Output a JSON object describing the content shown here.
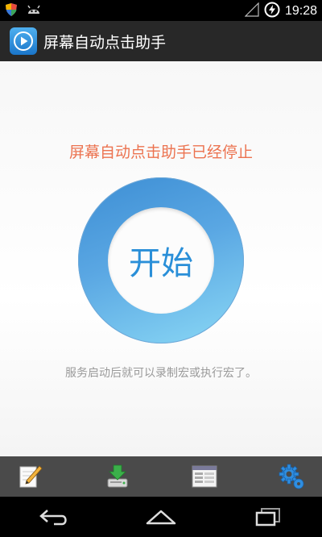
{
  "status_bar": {
    "time": "19:28",
    "icons": [
      "shield-icon",
      "android-robot-icon",
      "signal-icon",
      "battery-charging-icon"
    ]
  },
  "action_bar": {
    "title": "屏幕自动点击助手",
    "icon": "play-icon"
  },
  "main": {
    "status_message": "屏幕自动点击助手已经停止",
    "start_button_label": "开始",
    "hint": "服务启动后就可以录制宏或执行宏了。",
    "colors": {
      "status": "#ec7350",
      "ring": "#5aa7e3",
      "label": "#2a8fd8",
      "hint": "#9a9a9a"
    }
  },
  "toolbar": {
    "items": [
      "edit-icon",
      "download-icon",
      "list-window-icon",
      "settings-gear-icon"
    ]
  },
  "navbar": {
    "items": [
      "back-icon",
      "home-icon",
      "recent-apps-icon"
    ]
  }
}
